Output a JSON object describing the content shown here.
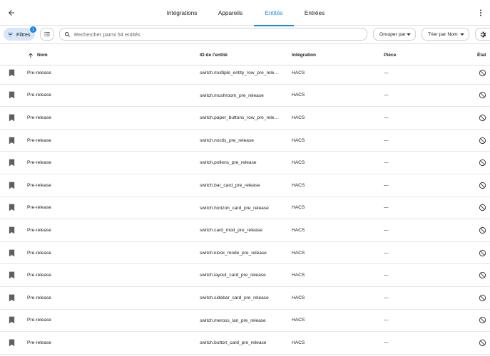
{
  "header": {
    "tabs": [
      {
        "label": "Intégrations",
        "active": false
      },
      {
        "label": "Appareils",
        "active": false
      },
      {
        "label": "Entités",
        "active": true
      },
      {
        "label": "Entrées",
        "active": false
      }
    ]
  },
  "toolbar": {
    "filters_label": "Filtres",
    "filters_count": "1",
    "search_placeholder": "Rechercher parmi 54 entités",
    "group_label": "Grouper par",
    "sort_label": "Trier par Nom"
  },
  "table": {
    "columns": {
      "name": "Nom",
      "entity_id": "ID de l'entité",
      "integration": "Intégration",
      "area": "Pièce",
      "state": "État"
    },
    "rows": [
      {
        "name": "Pre-release",
        "entity_id": "switch.multiple_entity_row_pre_release",
        "integration": "HACS",
        "area": "—"
      },
      {
        "name": "Pre-release",
        "entity_id": "switch.mushroom_pre_release",
        "integration": "HACS",
        "area": "—"
      },
      {
        "name": "Pre-release",
        "entity_id": "switch.paper_buttons_row_pre_release",
        "integration": "HACS",
        "area": "—"
      },
      {
        "name": "Pre-release",
        "entity_id": "switch.noctis_pre_release",
        "integration": "HACS",
        "area": "—"
      },
      {
        "name": "Pre-release",
        "entity_id": "switch.pollens_pre_release",
        "integration": "HACS",
        "area": "—"
      },
      {
        "name": "Pre-release",
        "entity_id": "switch.bar_card_pre_release",
        "integration": "HACS",
        "area": "—"
      },
      {
        "name": "Pre-release",
        "entity_id": "switch.horizon_card_pre_release",
        "integration": "HACS",
        "area": "—"
      },
      {
        "name": "Pre-release",
        "entity_id": "switch.card_mod_pre_release",
        "integration": "HACS",
        "area": "—"
      },
      {
        "name": "Pre-release",
        "entity_id": "switch.kiosk_mode_pre_release",
        "integration": "HACS",
        "area": "—"
      },
      {
        "name": "Pre-release",
        "entity_id": "switch.layout_card_pre_release",
        "integration": "HACS",
        "area": "—"
      },
      {
        "name": "Pre-release",
        "entity_id": "switch.sidebar_card_pre_release",
        "integration": "HACS",
        "area": "—"
      },
      {
        "name": "Pre-release",
        "entity_id": "switch.meross_lan_pre_release",
        "integration": "HACS",
        "area": "—"
      },
      {
        "name": "Pre-release",
        "entity_id": "switch.button_card_pre_release",
        "integration": "HACS",
        "area": "—"
      }
    ]
  },
  "icons": {
    "back": "arrow-left-icon",
    "more": "dots-vertical-icon",
    "filter": "filter-icon",
    "select": "select-mode-icon",
    "search": "search-icon",
    "settings": "gear-icon",
    "sort": "arrow-up-icon",
    "row": "bookmark-icon",
    "state": "unavailable-icon"
  },
  "colors": {
    "accent": "#1e88e5",
    "filter_chip": "#d8e6f7"
  }
}
